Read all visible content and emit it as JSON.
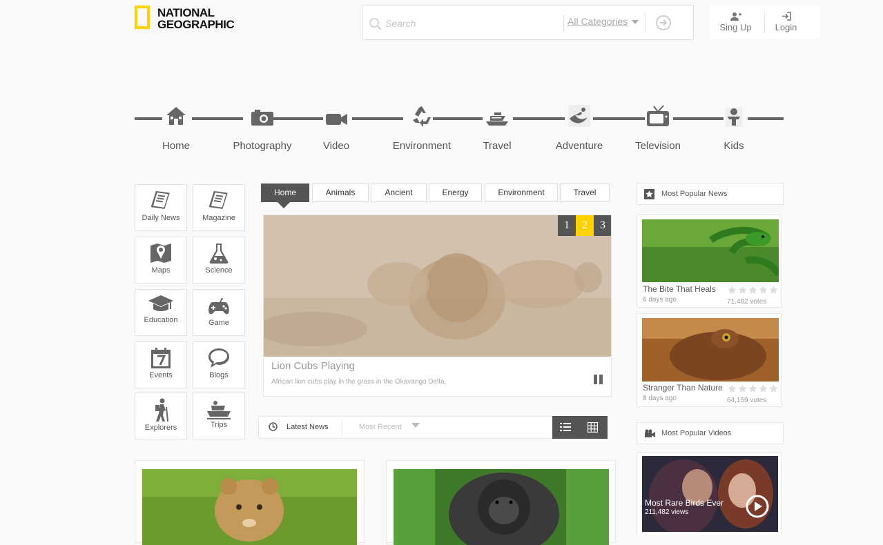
{
  "brand": {
    "line1": "NATIONAL",
    "line2": "GEOGRAPHIC",
    "accent": "#ffd200"
  },
  "search": {
    "placeholder": "Search",
    "category": "All Categories"
  },
  "auth": {
    "signup": "Sing Up",
    "login": "Login"
  },
  "nav": [
    {
      "label": "Home",
      "icon": "house-icon"
    },
    {
      "label": "Photography",
      "icon": "camera-icon"
    },
    {
      "label": "Video",
      "icon": "video-camera-icon"
    },
    {
      "label": "Environment",
      "icon": "recycle-icon"
    },
    {
      "label": "Travel",
      "icon": "ship-icon"
    },
    {
      "label": "Adventure",
      "icon": "adventure-icon"
    },
    {
      "label": "Television",
      "icon": "tv-icon"
    },
    {
      "label": "Kids",
      "icon": "kid-icon"
    }
  ],
  "tiles": [
    {
      "label": "Daily News",
      "icon": "newspaper-icon"
    },
    {
      "label": "Magazine",
      "icon": "magazine-icon"
    },
    {
      "label": "Maps",
      "icon": "map-icon"
    },
    {
      "label": "Science",
      "icon": "flask-icon"
    },
    {
      "label": "Education",
      "icon": "graduation-cap-icon"
    },
    {
      "label": "Game",
      "icon": "gamepad-icon"
    },
    {
      "label": "Events",
      "icon": "calendar-icon"
    },
    {
      "label": "Blogs",
      "icon": "speech-bubble-icon"
    },
    {
      "label": "Explorers",
      "icon": "hiker-icon"
    },
    {
      "label": "Trips",
      "icon": "boat-icon"
    }
  ],
  "tabs": [
    "Home",
    "Animals",
    "Ancient",
    "Energy",
    "Environment",
    "Travel"
  ],
  "slider": {
    "pages": [
      "1",
      "2",
      "3"
    ],
    "active_page": "2",
    "title": "Lion Cubs Playing",
    "description": "African lion cubs play in the grass in the Okavango Delta."
  },
  "news_bar": {
    "label": "Latest News",
    "sort": "Most Recent"
  },
  "popular_news": {
    "heading": "Most Popular News",
    "items": [
      {
        "title": "The Bite That Heals",
        "age": "6 days ago",
        "votes": "71,482 votes",
        "rating": 0
      },
      {
        "title": "Stranger Than Nature",
        "age": "8 days ago",
        "votes": "64,159 votes",
        "rating": 0
      }
    ]
  },
  "popular_videos": {
    "heading": "Most Popular Videos",
    "items": [
      {
        "title": "Most Rare Birds Ever",
        "views": "211,482 views"
      }
    ]
  },
  "colors": {
    "icon_gray": "#666666",
    "active_pager": "#ffd200",
    "dark": "#555555"
  }
}
